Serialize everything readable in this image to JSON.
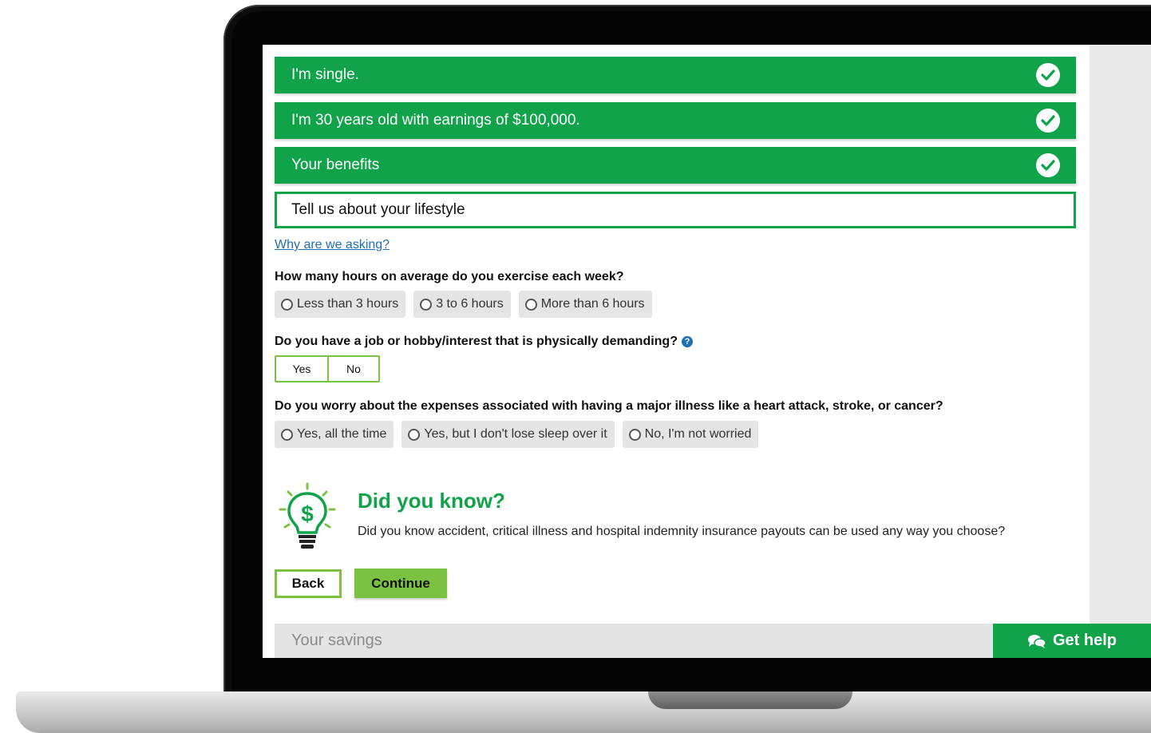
{
  "steps": [
    {
      "label": "I'm single."
    },
    {
      "label": "I'm 30 years old with earnings of $100,000."
    },
    {
      "label": "Your benefits"
    }
  ],
  "current_step": "Tell us about your lifestyle",
  "why_link": "Why are we asking?",
  "q1": {
    "question": "How many hours on average do you exercise each week?",
    "options": [
      "Less than 3 hours",
      "3 to 6 hours",
      "More than 6 hours"
    ]
  },
  "q2": {
    "question": "Do you have a job or hobby/interest that is physically demanding?",
    "help_icon": "question-circle-icon",
    "yes": "Yes",
    "no": "No"
  },
  "q3": {
    "question": "Do you worry about the expenses associated with having a major illness like a heart attack, stroke, or cancer?",
    "options": [
      "Yes, all the time",
      "Yes, but I don't lose sleep over it",
      "No, I'm not worried"
    ]
  },
  "did_you_know": {
    "title": "Did you know?",
    "text": "Did you know accident, critical illness and hospital indemnity insurance payouts can be used any way you choose?",
    "icon": "lightbulb-dollar-icon"
  },
  "buttons": {
    "back": "Back",
    "continue": "Continue"
  },
  "savings_label": "Your savings",
  "get_help": "Get help",
  "colors": {
    "brand_green": "#10a34a",
    "accent_green": "#7cc242",
    "link_blue": "#1f6fb5"
  }
}
